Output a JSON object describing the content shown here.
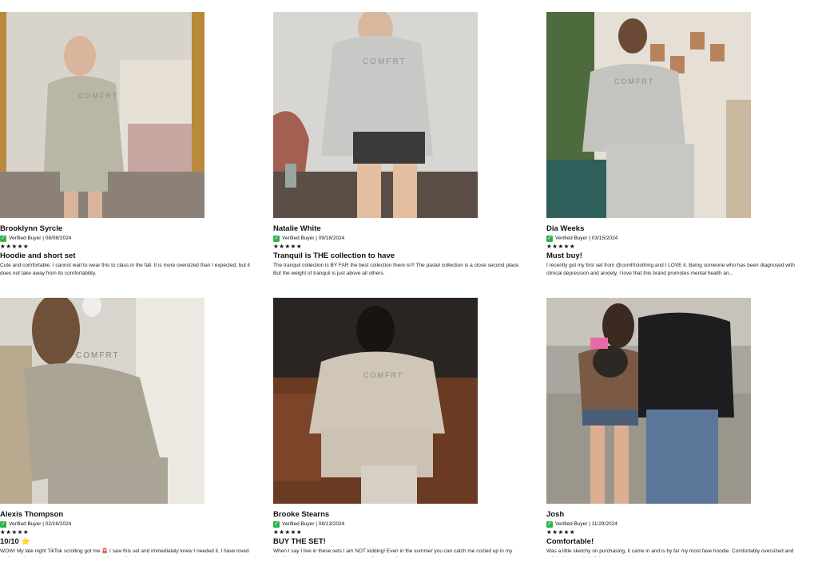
{
  "reviews": [
    {
      "name": "Brooklynn Syrcle",
      "verified": "Verified Buyer | 08/08/2024",
      "stars": "★★★★★",
      "title": "Hoodie and short set",
      "body": "Cute and comfortable. I cannot wait to wear this to class in the fall. It is more oversized than I expected, but it does not take away from its comfortability.",
      "photo_alt": "Mirror selfie in sage hoodie and shorts"
    },
    {
      "name": "Natalie White",
      "verified": "Verified Buyer | 09/18/2024",
      "stars": "★★★★★",
      "title": "Tranquil is THE collection to have",
      "body": "The tranquil collection is BY FAR the best collection there is!!! The pastel collection is a close second place. But the weight of tranquil is just above all others.",
      "photo_alt": "Gray hoodie with black shorts"
    },
    {
      "name": "Dia Weeks",
      "verified": "Verified Buyer | 03/15/2024",
      "stars": "★★★★★",
      "title": "Must buy!",
      "body": "I recently got my first set from @comfrtclothing and I LOVE it. Being someone who has been diagnosed with clinical depression and anxiety, I love that this brand promotes mental health an...",
      "photo_alt": "Light gray hoodie and sweatpants set"
    },
    {
      "name": "Alexis Thompson",
      "verified": "Verified Buyer | 02/16/2024",
      "stars": "★★★★★",
      "title": "10/10 ⭐",
      "body": "WOW! My late night TikTok scrolling got me 🚨 I saw this set and immediately knew I needed it. I have loved my first order and have worn the set nonstop since getting it.",
      "photo_alt": "Mirror selfie in sage hoodie set"
    },
    {
      "name": "Brooke Stearns",
      "verified": "Verified Buyer | 08/13/2024",
      "stars": "★★★★★",
      "title": "BUY THE SET!",
      "body": "When I say I live in these sets I am NOT kidding! Even in the summer you can catch me cozied up in my hoodie and sweats because they are so soft and comfy.",
      "photo_alt": "Sitting on leather couch in cream set"
    },
    {
      "name": "Josh",
      "verified": "Verified Buyer | 11/29/2024",
      "stars": "★★★★★",
      "title": "Comfortable!",
      "body": "Was a little sketchy on purchasing, it came in and is by far my most fave hoodie. Comfortably oversized and soft inside, would definitely buy again in another color.",
      "photo_alt": "Couple outdoors with dog, black hoodie"
    }
  ],
  "brand_print": "COMFRT",
  "colors": {
    "verified_green": "#2fb14b",
    "text": "#111111"
  }
}
